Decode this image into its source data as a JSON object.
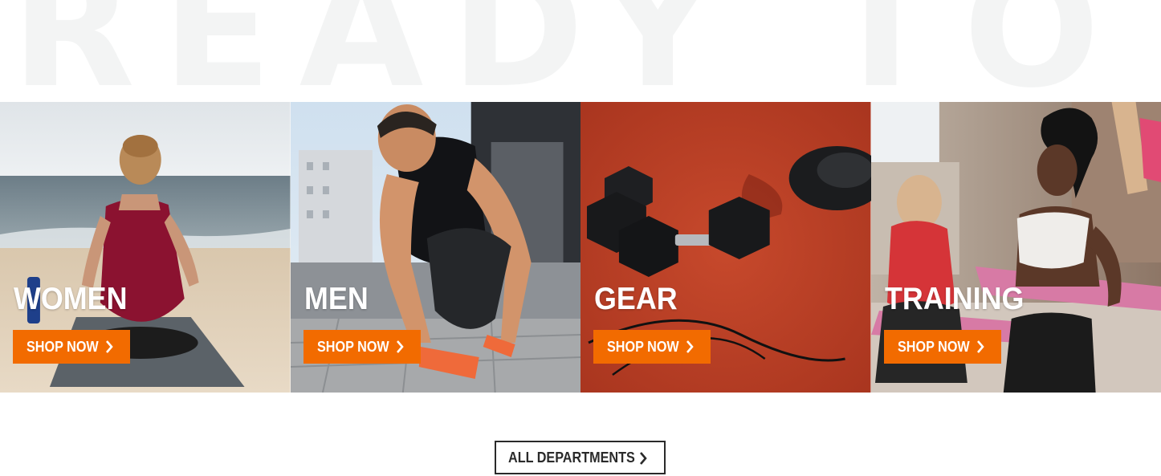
{
  "hero": {
    "watermark_text": "READY TO GO"
  },
  "categories": [
    {
      "title": "WOMEN",
      "button_label": "SHOP NOW",
      "image": "woman-meditating-on-beach-photo",
      "chevron_icon": "chevron-right-icon"
    },
    {
      "title": "MEN",
      "button_label": "SHOP NOW",
      "image": "man-tying-running-shoe-photo",
      "chevron_icon": "chevron-right-icon"
    },
    {
      "title": "GEAR",
      "button_label": "SHOP NOW",
      "image": "dumbbells-on-track-photo",
      "chevron_icon": "chevron-right-icon"
    },
    {
      "title": "TRAINING",
      "button_label": "SHOP NOW",
      "image": "women-fitness-class-photo",
      "chevron_icon": "chevron-right-icon"
    }
  ],
  "footer": {
    "all_departments_label": "ALL DEPARTMENTS",
    "chevron_icon": "chevron-right-icon"
  },
  "colors": {
    "accent": "#f26b00",
    "watermark": "#f3f4f4",
    "outline_button": "#2a2a2a",
    "text_on_image": "#ffffff"
  }
}
